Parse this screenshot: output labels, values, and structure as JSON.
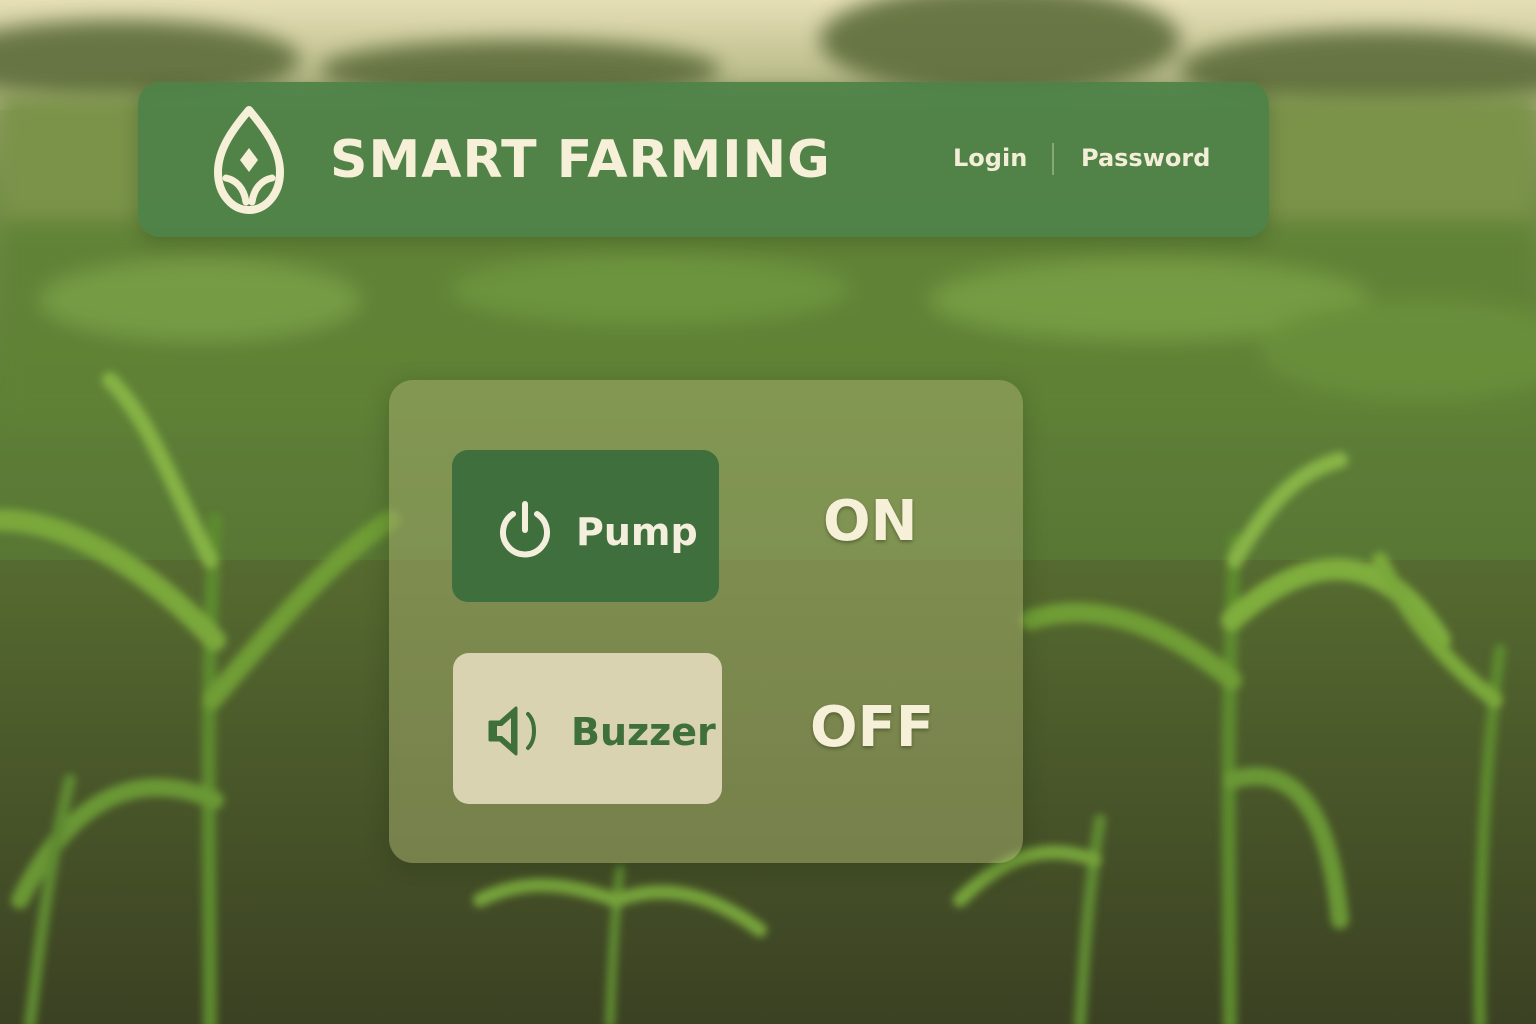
{
  "header": {
    "title": "SMART FARMING",
    "logo_icon": "leaf-drop-icon",
    "nav": [
      {
        "label": "Login"
      },
      {
        "label": "Password"
      }
    ]
  },
  "controls": [
    {
      "name": "Pump",
      "icon": "power-icon",
      "status": "ON",
      "active": true
    },
    {
      "name": "Buzzer",
      "icon": "speaker-icon",
      "status": "OFF",
      "active": false
    }
  ],
  "colors": {
    "header_bg": "#4e8248",
    "pump_button": "#3e6f3c",
    "buzzer_button": "#d9d3b2",
    "text_light": "#f6f0d8"
  }
}
